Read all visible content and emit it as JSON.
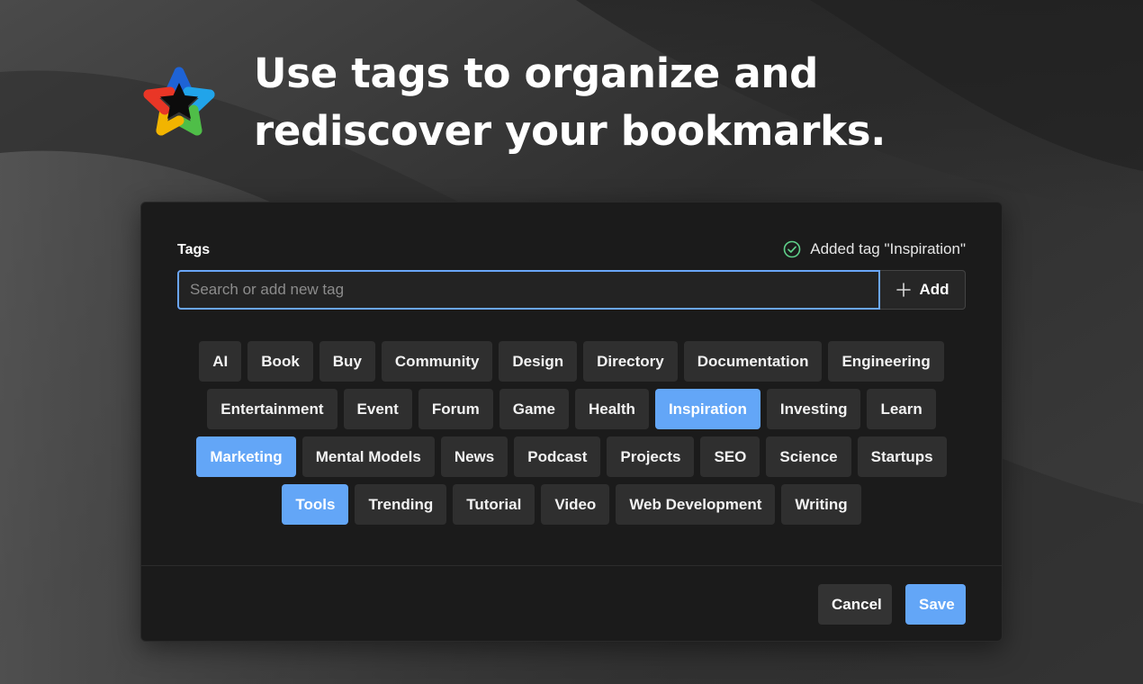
{
  "hero": {
    "headline": "Use tags to organize and rediscover your bookmarks."
  },
  "dialog": {
    "tags_label": "Tags",
    "status_text": "Added tag \"Inspiration\"",
    "search_placeholder": "Search or add new tag",
    "search_value": "",
    "add_label": "Add",
    "tags": [
      {
        "label": "AI",
        "selected": false
      },
      {
        "label": "Book",
        "selected": false
      },
      {
        "label": "Buy",
        "selected": false
      },
      {
        "label": "Community",
        "selected": false
      },
      {
        "label": "Design",
        "selected": false
      },
      {
        "label": "Directory",
        "selected": false
      },
      {
        "label": "Documentation",
        "selected": false
      },
      {
        "label": "Engineering",
        "selected": false
      },
      {
        "label": "Entertainment",
        "selected": false
      },
      {
        "label": "Event",
        "selected": false
      },
      {
        "label": "Forum",
        "selected": false
      },
      {
        "label": "Game",
        "selected": false
      },
      {
        "label": "Health",
        "selected": false
      },
      {
        "label": "Inspiration",
        "selected": true
      },
      {
        "label": "Investing",
        "selected": false
      },
      {
        "label": "Learn",
        "selected": false
      },
      {
        "label": "Marketing",
        "selected": true
      },
      {
        "label": "Mental Models",
        "selected": false
      },
      {
        "label": "News",
        "selected": false
      },
      {
        "label": "Podcast",
        "selected": false
      },
      {
        "label": "Projects",
        "selected": false
      },
      {
        "label": "SEO",
        "selected": false
      },
      {
        "label": "Science",
        "selected": false
      },
      {
        "label": "Startups",
        "selected": false
      },
      {
        "label": "Tools",
        "selected": true
      },
      {
        "label": "Trending",
        "selected": false
      },
      {
        "label": "Tutorial",
        "selected": false
      },
      {
        "label": "Video",
        "selected": false
      },
      {
        "label": "Web Development",
        "selected": false
      },
      {
        "label": "Writing",
        "selected": false
      }
    ],
    "cancel_label": "Cancel",
    "save_label": "Save"
  },
  "colors": {
    "accent": "#63a6f7",
    "dialog_bg": "#1b1b1b",
    "tag_bg": "#2f2f2f",
    "success": "#5fd08a"
  },
  "icons": {
    "logo": "star-logo-icon",
    "status": "check-circle-icon",
    "add": "plus-icon"
  }
}
